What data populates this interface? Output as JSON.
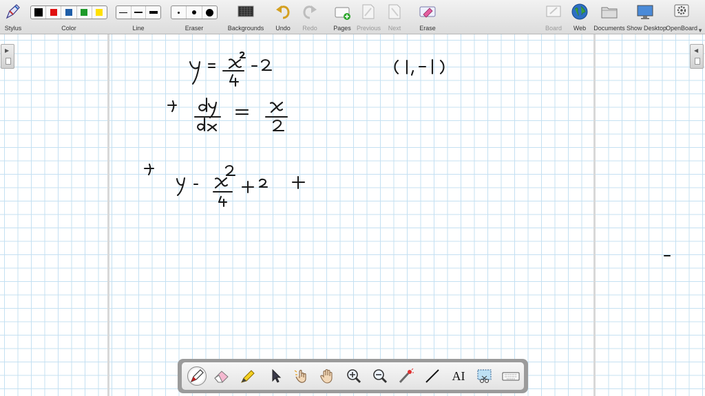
{
  "toolbar": {
    "stylus_label": "Stylus",
    "color_label": "Color",
    "line_label": "Line",
    "eraser_label": "Eraser",
    "backgrounds_label": "Backgrounds",
    "undo_label": "Undo",
    "redo_label": "Redo",
    "pages_label": "Pages",
    "previous_label": "Previous",
    "next_label": "Next",
    "erase_label": "Erase",
    "board_label": "Board",
    "web_label": "Web",
    "documents_label": "Documents",
    "show_desktop_label": "Show Desktop",
    "openboard_label": "OpenBoard",
    "colors": [
      "#000000",
      "#e01010",
      "#1f5ea8",
      "#1e9a2a",
      "#ffe000"
    ],
    "selected_color": "#000000"
  },
  "canvas": {
    "background": "grid",
    "grid_color": "#c4e0f2",
    "ink_color": "#1a1a1a"
  },
  "dock": {
    "tools": [
      "pen-icon",
      "eraser-icon",
      "marker-icon",
      "selector-icon",
      "play-icon",
      "hand-icon",
      "zoom-in-icon",
      "zoom-out-icon",
      "laser-pointer-icon",
      "line-icon",
      "text-icon",
      "capture-icon",
      "keyboard-icon"
    ],
    "active_tool": "pen-icon",
    "text_tool_label": "AI"
  }
}
